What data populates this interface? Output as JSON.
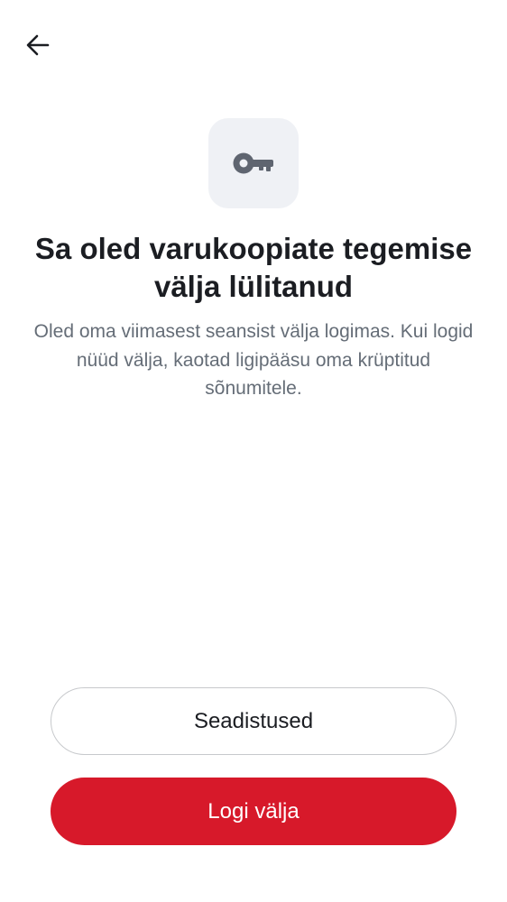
{
  "icons": {
    "back": "arrow-left-icon",
    "hero": "key-icon"
  },
  "colors": {
    "primary": "#d7192a",
    "icon_tile_background": "#eff1f5",
    "icon_foreground": "#5f6570",
    "text_primary": "#1b1d22",
    "text_secondary": "#656d77",
    "button_border": "#c7c9cc"
  },
  "content": {
    "title": "Sa oled varukoopiate tegemise välja lülitanud",
    "description": "Oled oma viimasest seansist välja logimas. Kui logid nüüd välja, kaotad ligipääsu oma krüptitud sõnumitele."
  },
  "actions": {
    "settings_label": "Seadistused",
    "sign_out_label": "Logi välja"
  }
}
